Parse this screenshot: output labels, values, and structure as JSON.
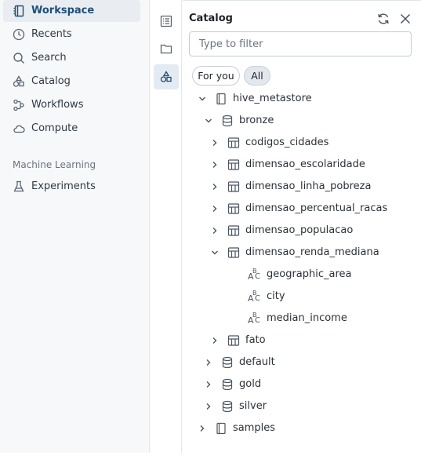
{
  "nav": {
    "items": [
      {
        "key": "workspace",
        "label": "Workspace",
        "icon": "workspace-icon",
        "active": true
      },
      {
        "key": "recents",
        "label": "Recents",
        "icon": "clock-icon"
      },
      {
        "key": "search",
        "label": "Search",
        "icon": "search-icon"
      },
      {
        "key": "catalog",
        "label": "Catalog",
        "icon": "catalog-icon"
      },
      {
        "key": "workflows",
        "label": "Workflows",
        "icon": "workflows-icon"
      },
      {
        "key": "compute",
        "label": "Compute",
        "icon": "cloud-icon"
      }
    ],
    "ml_section": "Machine Learning",
    "ml_items": [
      {
        "key": "experiments",
        "label": "Experiments",
        "icon": "flask-icon"
      }
    ]
  },
  "rail": {
    "buttons": [
      "outline-icon",
      "folder-icon",
      "catalog-icon"
    ],
    "active": "catalog-icon"
  },
  "panel": {
    "title": "Catalog",
    "filter_placeholder": "Type to filter",
    "filter_value": "",
    "pills": {
      "for_you": "For you",
      "all": "All"
    },
    "active_pill": "all"
  },
  "tree": [
    {
      "label": "hive_metastore",
      "type": "catalog",
      "depth": 0,
      "expanded": true
    },
    {
      "label": "bronze",
      "type": "schema",
      "depth": 1,
      "expanded": true
    },
    {
      "label": "codigos_cidades",
      "type": "table",
      "depth": 2,
      "expanded": false
    },
    {
      "label": "dimensao_escolaridade",
      "type": "table",
      "depth": 2,
      "expanded": false
    },
    {
      "label": "dimensao_linha_pobreza",
      "type": "table",
      "depth": 2,
      "expanded": false
    },
    {
      "label": "dimensao_percentual_racas",
      "type": "table",
      "depth": 2,
      "expanded": false
    },
    {
      "label": "dimensao_populacao",
      "type": "table",
      "depth": 2,
      "expanded": false
    },
    {
      "label": "dimensao_renda_mediana",
      "type": "table",
      "depth": 2,
      "expanded": true
    },
    {
      "label": "geographic_area",
      "type": "column",
      "depth": 3
    },
    {
      "label": "city",
      "type": "column",
      "depth": 3
    },
    {
      "label": "median_income",
      "type": "column",
      "depth": 3
    },
    {
      "label": "fato",
      "type": "table",
      "depth": 2,
      "expanded": false
    },
    {
      "label": "default",
      "type": "schema",
      "depth": 1,
      "expanded": false
    },
    {
      "label": "gold",
      "type": "schema",
      "depth": 1,
      "expanded": false
    },
    {
      "label": "silver",
      "type": "schema",
      "depth": 1,
      "expanded": false
    },
    {
      "label": "samples",
      "type": "catalog",
      "depth": 0,
      "expanded": false
    }
  ]
}
